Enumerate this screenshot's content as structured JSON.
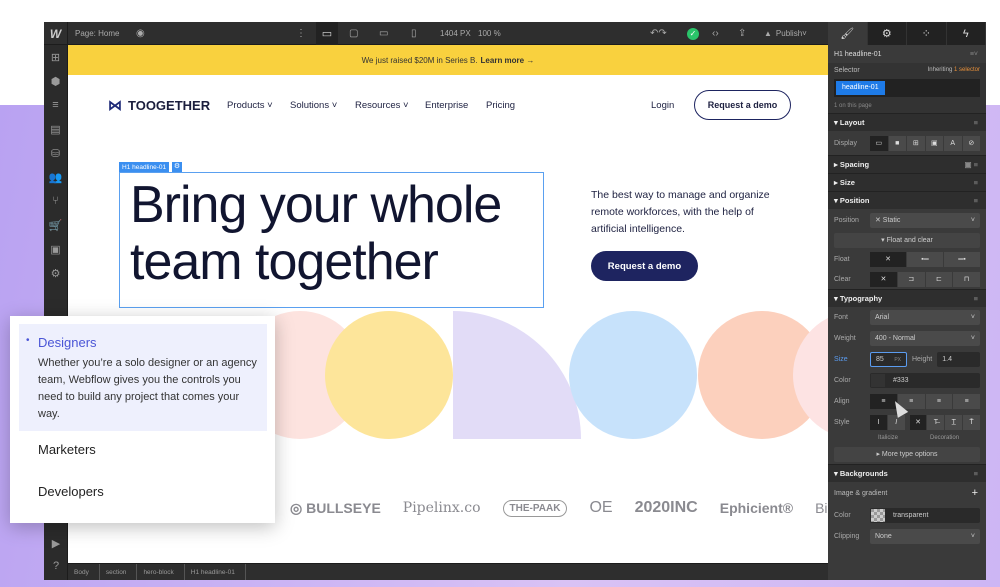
{
  "topbar": {
    "page_label": "Page: Home",
    "width": "1404 PX",
    "zoom": "100 %",
    "publish": "Publish"
  },
  "panel_tabs": [
    "brush-icon",
    "gear-icon",
    "interactions-icon",
    "lightning-icon"
  ],
  "canvas": {
    "banner": {
      "text": "We just raised $20M in Series B.",
      "link": "Learn more →"
    },
    "nav": {
      "brand": "TOOGETHER",
      "items": [
        "Products ˅",
        "Solutions ˅",
        "Resources ˅",
        "Enterprise",
        "Pricing"
      ],
      "login": "Login",
      "demo": "Request a demo"
    },
    "tag": "H1 headline-01",
    "headline": "Bring your whole team together",
    "subtext": "The best way to manage and organize remote workforces, with the help of artificial intelligence.",
    "cta": "Request a demo",
    "shape_colors": [
      "#fde3df",
      "#fde59a",
      "#e2dcf7",
      "#c7e2fb",
      "#fcd0bd",
      "#fde3e3"
    ],
    "logos": [
      "◎ BULLSEYE",
      "Pipelinx.co",
      "THE-PAAK",
      "OE",
      "2020INC",
      "Ephicient®",
      "Bir"
    ]
  },
  "breadcrumbs": [
    "Body",
    "section",
    "hero-block",
    "H1 headline-01"
  ],
  "panel": {
    "element": "H1 headline-01",
    "selector_label": "Selector",
    "inheriting": "Inheriting",
    "inheriting_link": "1 selector",
    "selector": "headline-01",
    "count": "1 on this page",
    "layout": "Layout",
    "display": "Display",
    "spacing": "Spacing",
    "size": "Size",
    "position_sec": "Position",
    "position": "Position",
    "position_val": "✕  Static",
    "float_clear": "▾  Float and clear",
    "float": "Float",
    "clear": "Clear",
    "typography": "Typography",
    "font": "Font",
    "font_val": "Arial",
    "weight": "Weight",
    "weight_val": "400 - Normal",
    "size_lbl": "Size",
    "size_val": "85",
    "size_unit": "PX",
    "height": "Height",
    "height_val": "1.4",
    "color": "Color",
    "color_val": "#333",
    "align": "Align",
    "style": "Style",
    "italicize": "Italicize",
    "decoration": "Decoration",
    "more": "▸  More type options",
    "backgrounds": "Backgrounds",
    "image_gradient": "Image & gradient",
    "bg_color": "Color",
    "bg_color_val": "transparent",
    "clipping": "Clipping",
    "clipping_val": "None"
  },
  "popup": {
    "active": "Designers",
    "desc": "Whether you’re a solo designer or an agency team, Webflow gives you the controls you need to build any project that comes your way.",
    "items": [
      "Marketers",
      "Developers"
    ]
  },
  "colors": {
    "accent": "#3b8ff0",
    "navy": "#1e2460",
    "banner": "#f9d13e",
    "selected": "#4a55d6"
  }
}
